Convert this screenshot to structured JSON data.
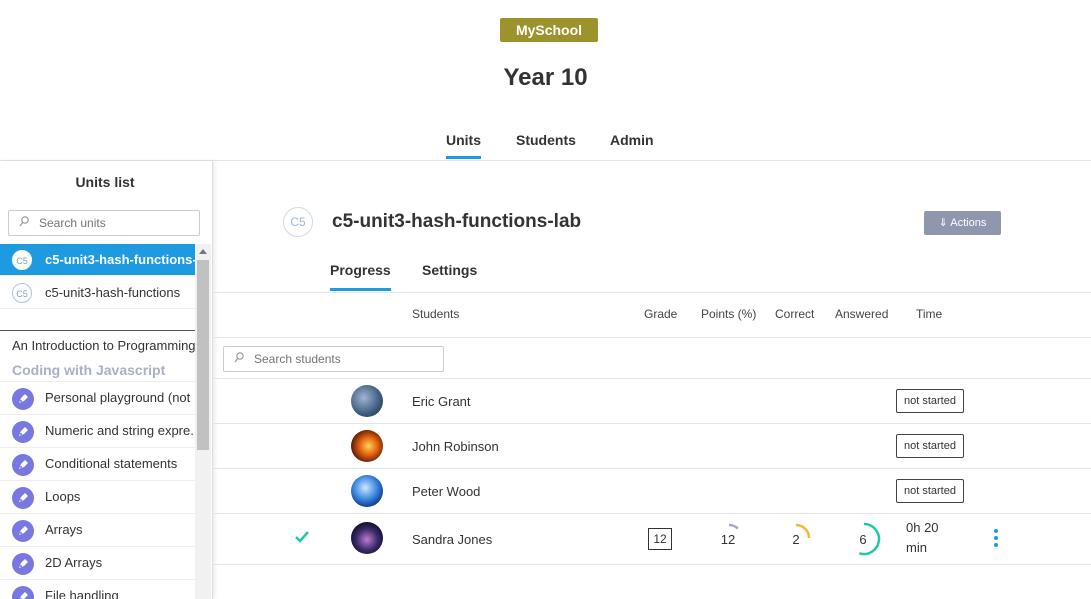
{
  "header": {
    "brand": "MySchool",
    "title": "Year 10",
    "nav": [
      {
        "label": "Units",
        "active": true
      },
      {
        "label": "Students",
        "active": false
      },
      {
        "label": "Admin",
        "active": false
      }
    ]
  },
  "sidebar": {
    "title": "Units list",
    "search_placeholder": "Search units",
    "units": [
      {
        "badge": "C5",
        "label": "c5-unit3-hash-functions-lab",
        "selected": true
      },
      {
        "badge": "C5",
        "label": "c5-unit3-hash-functions",
        "selected": false
      }
    ],
    "course_title": "An Introduction to Programming",
    "course_subtitle": "Coding with Javascript",
    "lessons": [
      {
        "label": "Personal playground (not"
      },
      {
        "label": "Numeric and string expre..."
      },
      {
        "label": "Conditional statements"
      },
      {
        "label": "Loops"
      },
      {
        "label": "Arrays"
      },
      {
        "label": "2D Arrays"
      },
      {
        "label": "File handling"
      }
    ]
  },
  "main": {
    "unit_badge": "C5",
    "unit_title": "c5-unit3-hash-functions-lab",
    "actions_label": "⇓ Actions",
    "tabs": [
      {
        "label": "Progress",
        "active": true
      },
      {
        "label": "Settings",
        "active": false
      }
    ],
    "columns": {
      "students": "Students",
      "grade": "Grade",
      "points": "Points (%)",
      "correct": "Correct",
      "answered": "Answered",
      "time": "Time"
    },
    "search_placeholder": "Search students",
    "students": [
      {
        "name": "Eric Grant",
        "status": "not started",
        "avatar": "earth-avatar",
        "avatar_color": "#5d7ea6"
      },
      {
        "name": "John Robinson",
        "status": "not started",
        "avatar": "fire-avatar",
        "avatar_color": "#d96a1e"
      },
      {
        "name": "Peter Wood",
        "status": "not started",
        "avatar": "planet-avatar",
        "avatar_color": "#2a6fd1"
      },
      {
        "name": "Sandra Jones",
        "completed": true,
        "avatar": "nebula-avatar",
        "avatar_color": "#3a2a5a",
        "grade": "12",
        "points": "12",
        "points_fraction": 0.12,
        "correct": "2",
        "correct_fraction": 0.25,
        "answered": "6",
        "answered_fraction": 0.55,
        "time_line1": "0h 20",
        "time_line2": "min"
      }
    ]
  },
  "colors": {
    "accent": "#1e9be0",
    "brand": "#9c932c",
    "points_ring": "#a8a8c8",
    "correct_ring": "#f3b93c",
    "answered_ring": "#20c9a4",
    "check": "#20c9a4"
  }
}
